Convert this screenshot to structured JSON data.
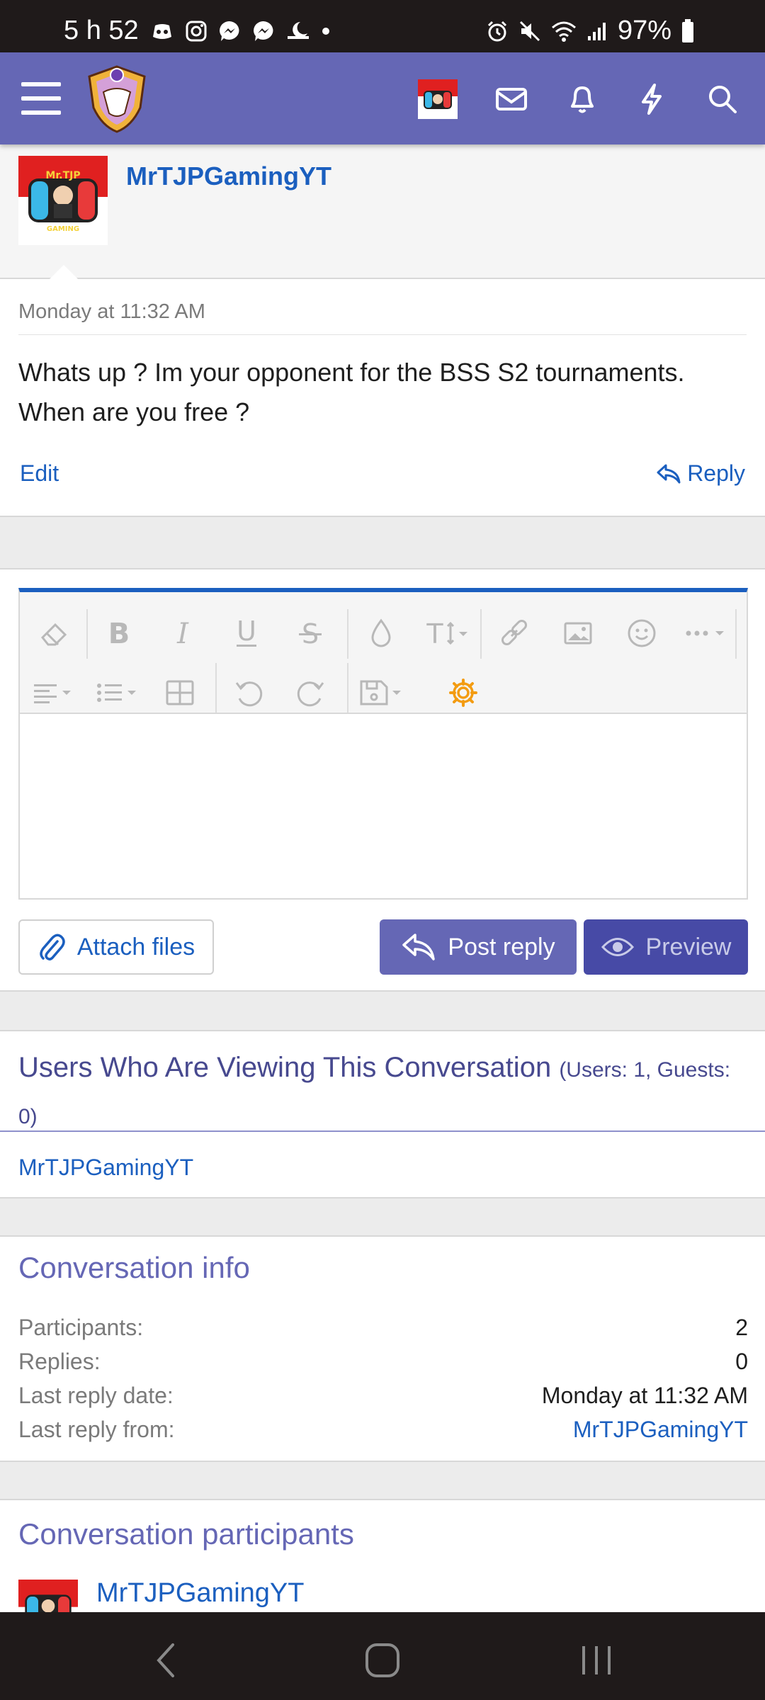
{
  "status_bar": {
    "time": "5 h 52",
    "battery": "97%"
  },
  "header": {
    "icons": [
      "menu-icon",
      "forum-logo",
      "user-avatar",
      "mail-icon",
      "bell-icon",
      "bolt-icon",
      "search-icon"
    ]
  },
  "message": {
    "author": "MrTJPGamingYT",
    "date": "Monday at 11:32 AM",
    "text": "Whats up ? Im your opponent for the BSS S2 tournaments. When are you free ?",
    "edit_label": "Edit",
    "reply_label": "Reply"
  },
  "editor": {
    "toolbar_row1": [
      "eraser-icon",
      "bold-icon",
      "italic-icon",
      "underline-icon",
      "strikethrough-icon",
      "color-drop-icon",
      "text-size-icon",
      "link-icon",
      "image-icon",
      "smiley-icon",
      "more-icon"
    ],
    "toolbar_row2": [
      "align-icon",
      "list-icon",
      "table-icon",
      "undo-icon",
      "redo-icon",
      "save-draft-icon",
      "gear-icon"
    ],
    "attach_label": "Attach files",
    "post_label": "Post reply",
    "preview_label": "Preview",
    "accent": "#1b5fbf"
  },
  "viewing": {
    "title": "Users Who Are Viewing This Conversation",
    "subtitle": "(Users: 1, Guests: 0)",
    "users": [
      "MrTJPGamingYT"
    ]
  },
  "info": {
    "title": "Conversation info",
    "rows": [
      {
        "key": "Participants:",
        "value": "2"
      },
      {
        "key": "Replies:",
        "value": "0"
      },
      {
        "key": "Last reply date:",
        "value": "Monday at 11:32 AM"
      },
      {
        "key": "Last reply from:",
        "value": "MrTJPGamingYT"
      }
    ]
  },
  "participants": {
    "title": "Conversation participants",
    "list": [
      "MrTJPGamingYT"
    ]
  },
  "colors": {
    "header_bg": "#6567b5",
    "link": "#1b5fbf",
    "section_title": "#6567b5",
    "preview_bg": "#474aa6"
  }
}
